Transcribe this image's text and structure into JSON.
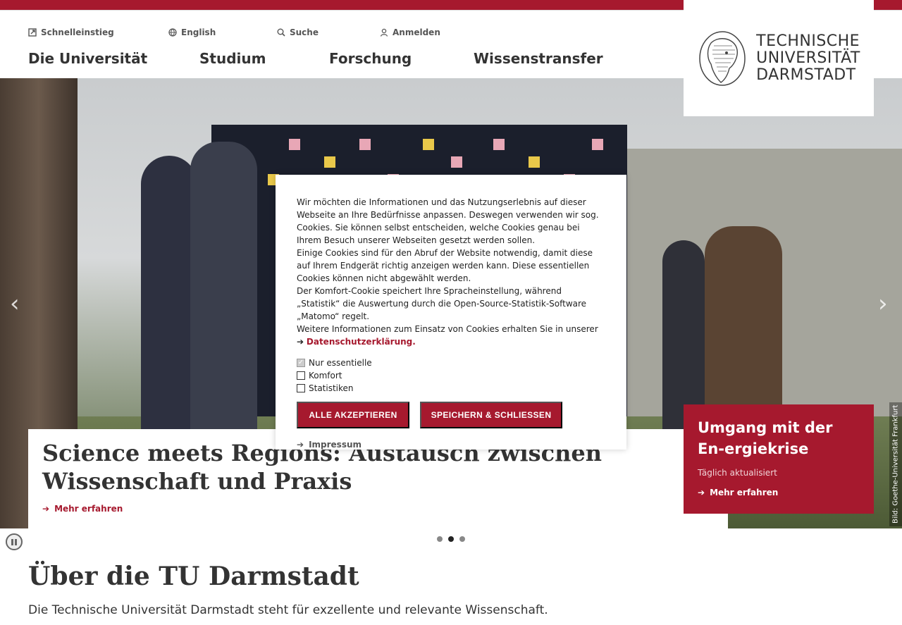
{
  "header": {
    "meta_nav": [
      {
        "label": "Schnelleinstieg",
        "icon": "external-link-icon"
      },
      {
        "label": "English",
        "icon": "globe-icon"
      },
      {
        "label": "Suche",
        "icon": "search-icon"
      },
      {
        "label": "Anmelden",
        "icon": "user-icon"
      }
    ],
    "main_nav": [
      "Die Universität",
      "Studium",
      "Forschung",
      "Wissenstransfer"
    ],
    "logo_lines": [
      "TECHNISCHE",
      "UNIVERSITÄT",
      "DARMSTADT"
    ]
  },
  "hero": {
    "caption_title": "Science meets Regions: Austausch zwischen Wissenschaft und Praxis",
    "caption_link": "Mehr erfahren",
    "photo_credit": "Bild: Goethe-Universität Frankfurt",
    "slide_count": 3,
    "active_slide": 2,
    "prev_arrow": "‹",
    "next_arrow": "›"
  },
  "promo": {
    "title": "Umgang mit der En-ergiekrise",
    "subtitle": "Täglich aktualisiert",
    "link": "Mehr erfahren"
  },
  "about": {
    "title": "Über die TU Darmstadt",
    "text": "Die Technische Universität Darmstadt steht für exzellente und relevante Wissenschaft."
  },
  "cookie": {
    "paragraph1": "Wir möchten die Informationen und das Nutzungserlebnis auf dieser Webseite an Ihre Bedürfnisse anpassen. Deswegen verwenden wir sog. Cookies. Sie können selbst entscheiden, welche Cookies genau bei Ihrem Besuch unserer Webseiten gesetzt werden sollen.",
    "paragraph2": "Einige Cookies sind für den Abruf der Website notwendig, damit diese auf Ihrem Endgerät richtig anzeigen werden kann. Diese essentiellen Cookies können nicht abgewählt werden.",
    "paragraph3": "Der Komfort-Cookie speichert Ihre Spracheinstellung, während „Statistik“ die Auswertung durch die Open-Source-Statistik-Software „Matomo“ regelt.",
    "paragraph4_prefix": "Weitere Informationen zum Einsatz von Cookies erhalten Sie in unserer ➔",
    "privacy_link": "Datenschutzerklärung.",
    "options": [
      {
        "label": "Nur essentielle",
        "checked": true,
        "disabled": true
      },
      {
        "label": "Komfort",
        "checked": false,
        "disabled": false
      },
      {
        "label": "Statistiken",
        "checked": false,
        "disabled": false
      }
    ],
    "accept_all": "ALLE AKZEPTIEREN",
    "save_close": "SPEICHERN & SCHLIESSEN",
    "imprint": "Impressum"
  },
  "colors": {
    "accent": "#a6192e",
    "text": "#333333"
  }
}
